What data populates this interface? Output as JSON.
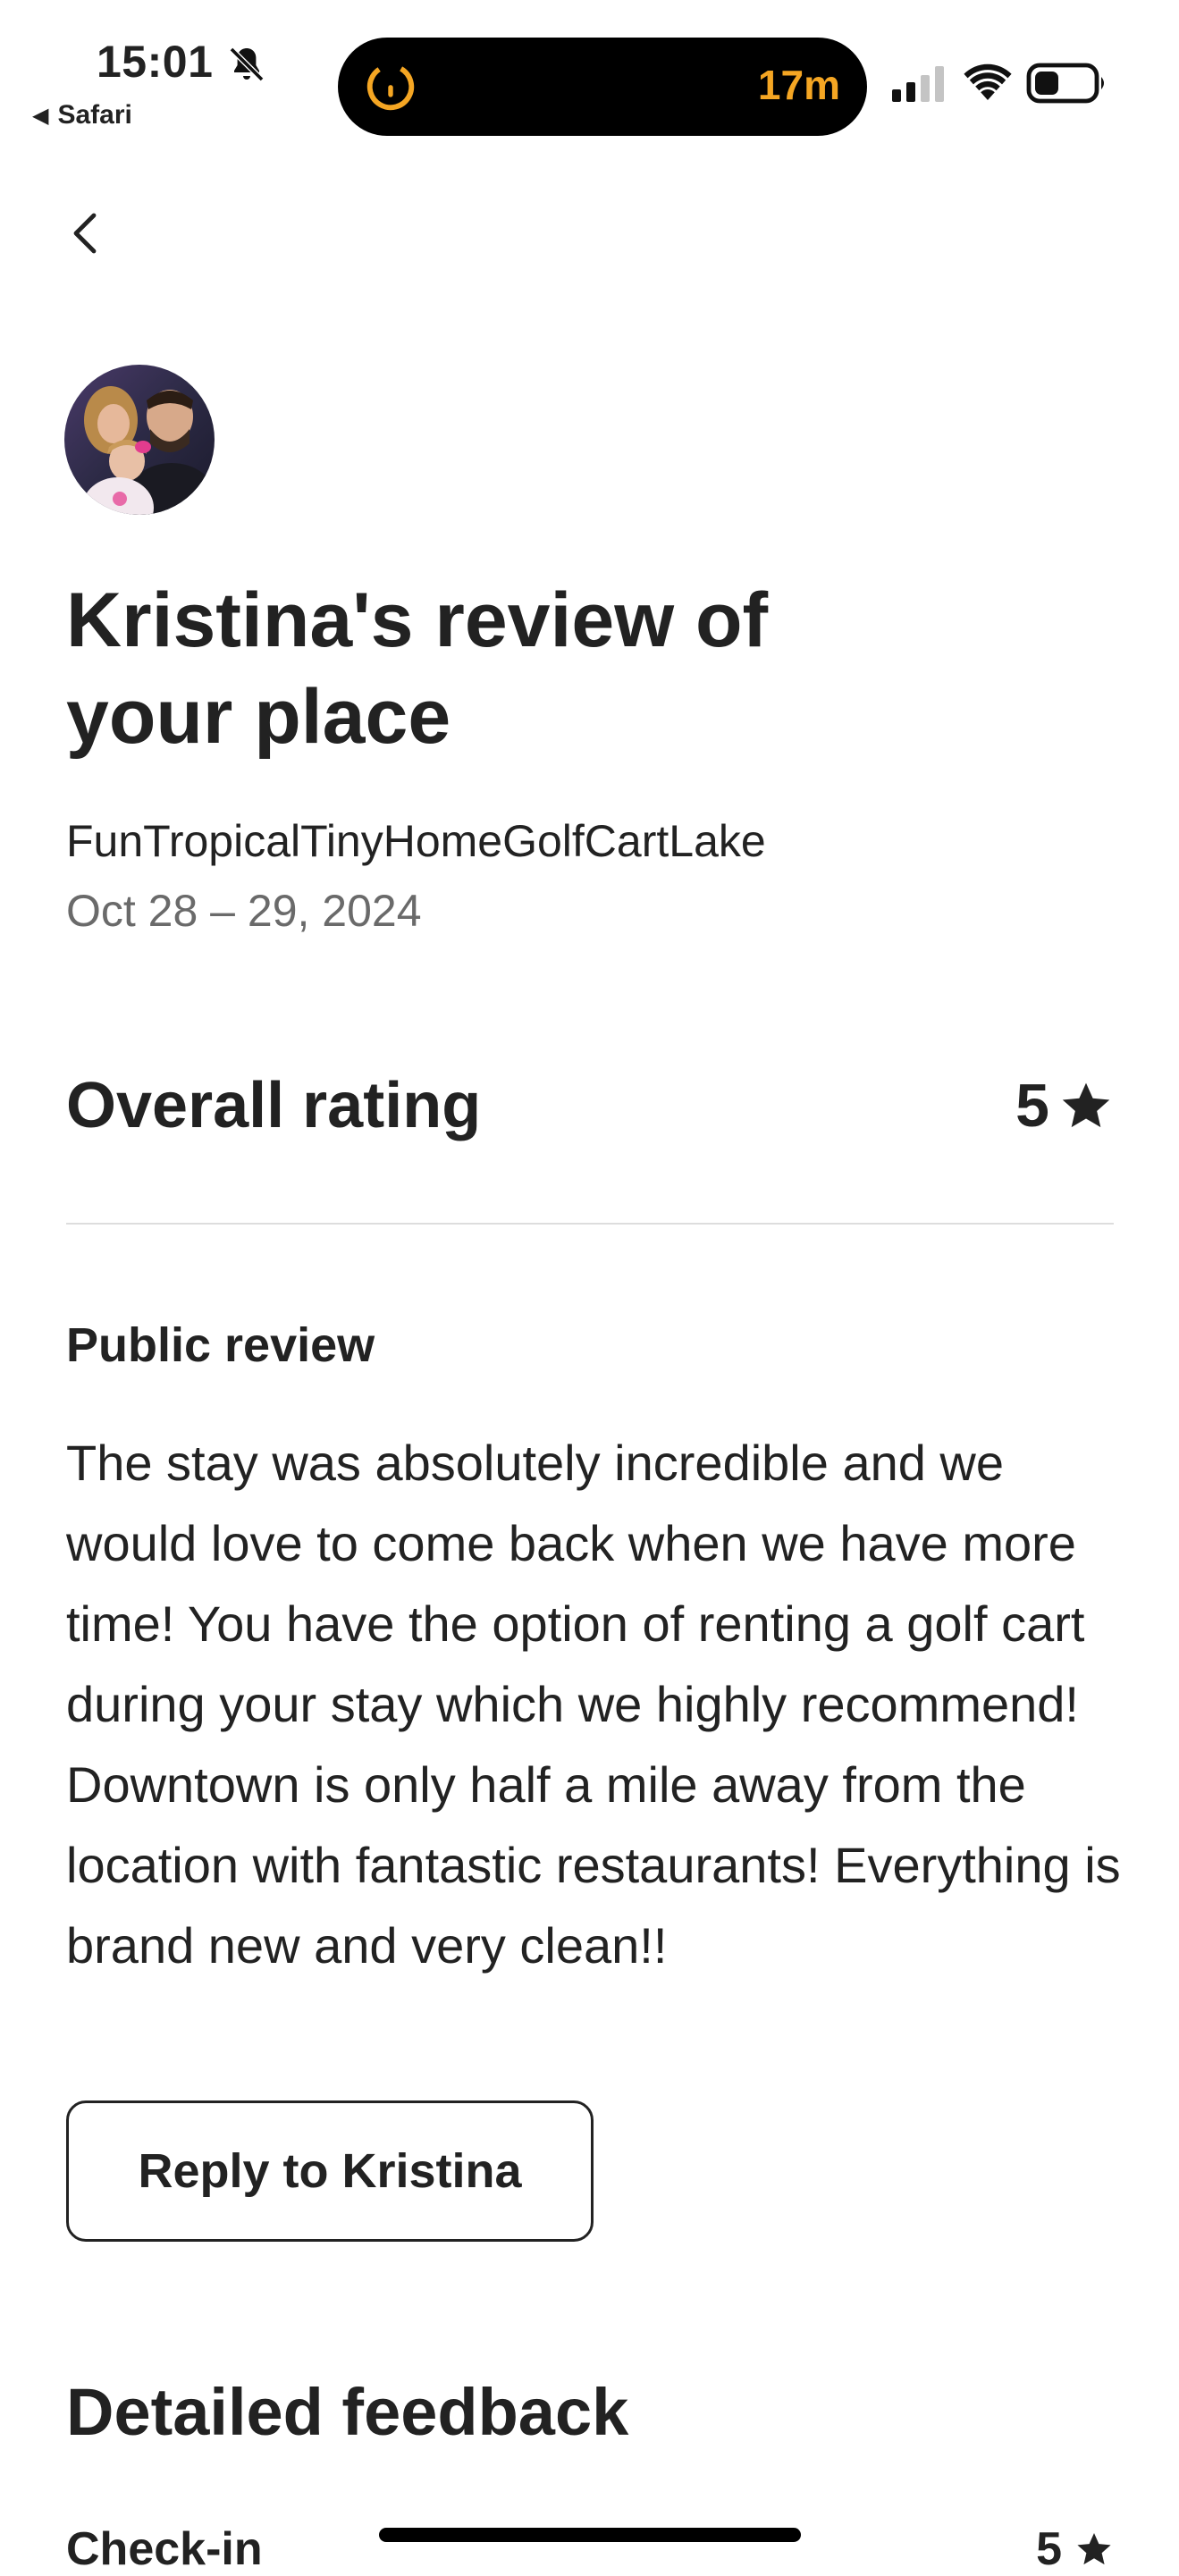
{
  "status_bar": {
    "time": "15:01",
    "back_app": "Safari",
    "island_timer": "17m",
    "icons": {
      "silent": "bell-slash-icon",
      "signal": "cellular-signal-icon",
      "wifi": "wifi-icon",
      "battery": "battery-icon",
      "timer": "timer-icon"
    },
    "accent_color": "#F5A623"
  },
  "nav": {
    "back_icon": "chevron-left-icon"
  },
  "review": {
    "title": "Kristina's review of your place",
    "listing_name": "FunTropicalTinyHomeGolfCartLake",
    "dates": "Oct 28 – 29, 2024",
    "overall_label": "Overall rating",
    "overall_value": "5",
    "public_review_label": "Public review",
    "public_review_text": "The stay was absolutely incredible and we would love to come back when we have more time! You have the option of renting a golf cart during your stay which we highly recommend! Downtown is only half a mile away from the location with fantastic restaurants! Everything is brand new and very clean!!",
    "reply_button": "Reply to Kristina"
  },
  "detailed_feedback": {
    "title": "Detailed feedback",
    "items": [
      {
        "label": "Check-in",
        "value": "5"
      }
    ]
  },
  "colors": {
    "text_primary": "#222222",
    "text_secondary": "#6a6a6a",
    "divider": "#dddddd"
  }
}
